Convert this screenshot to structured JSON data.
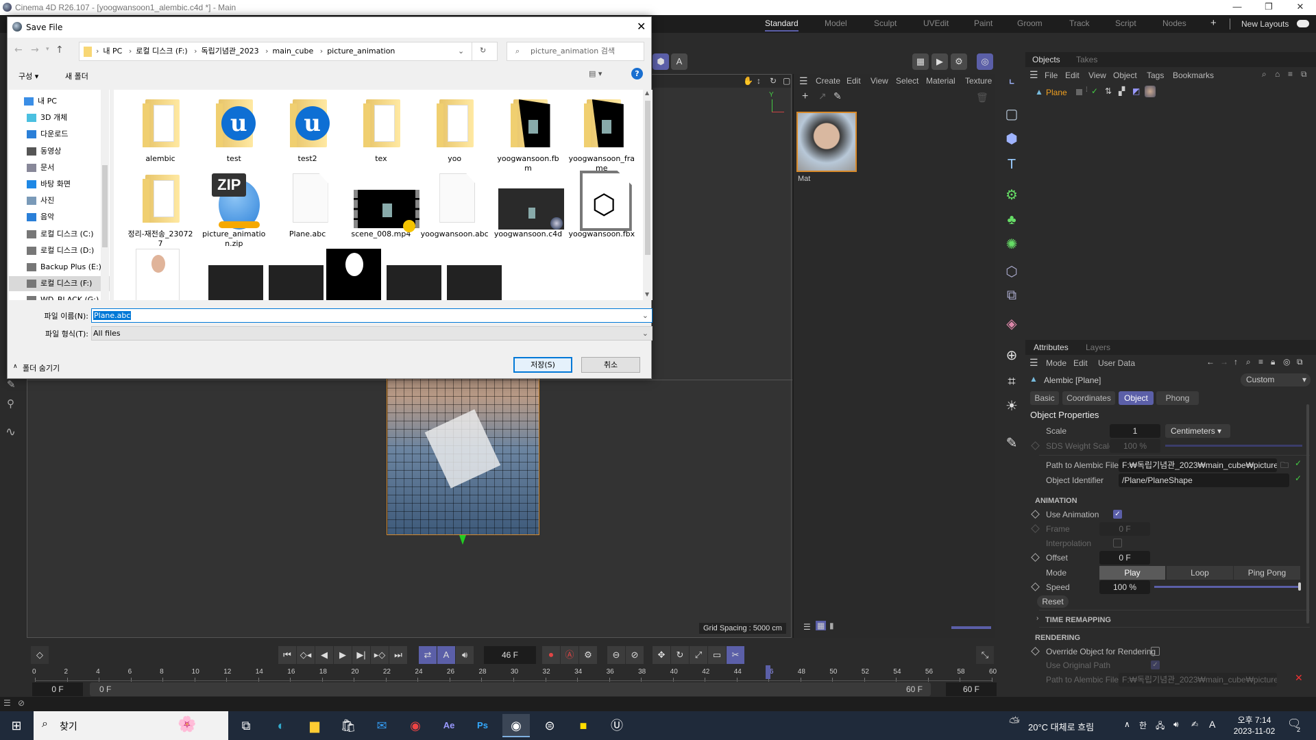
{
  "app": {
    "title": "Cinema 4D R26.107 - [yoogwansoon1_alembic.c4d *] - Main",
    "layouts": [
      "Standard",
      "Model",
      "Sculpt",
      "UVEdit",
      "Paint",
      "Groom",
      "Track",
      "Script",
      "Nodes"
    ],
    "active_layout": "Standard",
    "new_layouts": "New Layouts",
    "accent": "#5b5fa8"
  },
  "dialog": {
    "title": "Save File",
    "breadcrumb": [
      "내 PC",
      "로컬 디스크 (F:)",
      "독립기념관_2023",
      "main_cube",
      "picture_animation"
    ],
    "search_placeholder": "picture_animation 검색",
    "organize": "구성 ▾",
    "new_folder": "새 폴더",
    "nav": [
      {
        "label": "내 PC",
        "icon": "pc-icon"
      },
      {
        "label": "3D 개체",
        "icon": "3d-objects-icon"
      },
      {
        "label": "다운로드",
        "icon": "download-icon"
      },
      {
        "label": "동영상",
        "icon": "video-icon"
      },
      {
        "label": "문서",
        "icon": "document-icon"
      },
      {
        "label": "바탕 화면",
        "icon": "desktop-icon"
      },
      {
        "label": "사진",
        "icon": "pictures-icon"
      },
      {
        "label": "음악",
        "icon": "music-icon"
      },
      {
        "label": "로컬 디스크 (C:)",
        "icon": "drive-icon"
      },
      {
        "label": "로컬 디스크 (D:)",
        "icon": "drive-icon"
      },
      {
        "label": "Backup Plus (E:)",
        "icon": "drive-icon"
      },
      {
        "label": "로컬 디스크 (F:)",
        "icon": "drive-icon"
      },
      {
        "label": "WD_BLACK (G:)",
        "icon": "drive-icon"
      }
    ],
    "selected_nav": "로컬 디스크 (F:)",
    "files": [
      {
        "name": "alembic",
        "type": "folder"
      },
      {
        "name": "test",
        "type": "unreal-folder"
      },
      {
        "name": "test2",
        "type": "unreal-folder"
      },
      {
        "name": "tex",
        "type": "folder"
      },
      {
        "name": "yoo",
        "type": "folder"
      },
      {
        "name": "yoogwansoon.fbm",
        "type": "folder-dark"
      },
      {
        "name": "yoogwansoon_frame",
        "type": "folder-dark"
      },
      {
        "name": "정리-재전송_230727",
        "type": "folder"
      },
      {
        "name": "picture_animation.zip",
        "type": "zip"
      },
      {
        "name": "Plane.abc",
        "type": "file"
      },
      {
        "name": "scene_008.mp4",
        "type": "video"
      },
      {
        "name": "yoogwansoon.abc",
        "type": "file"
      },
      {
        "name": "yoogwansoon.c4d",
        "type": "c4d"
      },
      {
        "name": "yoogwansoon.fbx",
        "type": "fbx"
      }
    ],
    "filename_label": "파일 이름(N):",
    "filename_value": "Plane.abc",
    "filetype_label": "파일 형식(T):",
    "filetype_value": "All files",
    "hide_folders": "폴더 숨기기",
    "save": "저장(S)",
    "cancel": "취소"
  },
  "viewport": {
    "grid_spacing": "Grid Spacing : 5000 cm",
    "axis_label": "Y"
  },
  "material_manager": {
    "menu": [
      "Create",
      "Edit",
      "View",
      "Select",
      "Material",
      "Texture"
    ],
    "materials": [
      {
        "name": "Mat"
      }
    ]
  },
  "objects": {
    "tabs": [
      "Objects",
      "Takes"
    ],
    "menu": [
      "File",
      "Edit",
      "View",
      "Object",
      "Tags",
      "Bookmarks"
    ],
    "items": [
      {
        "name": "Plane"
      }
    ]
  },
  "attributes": {
    "tabs": [
      "Attributes",
      "Layers"
    ],
    "menu": [
      "Mode",
      "Edit",
      "User Data"
    ],
    "object_title": "Alembic [Plane]",
    "preset": "Custom",
    "subtabs": [
      "Basic",
      "Coordinates",
      "Object",
      "Phong"
    ],
    "active_subtab": "Object",
    "section_title": "Object Properties",
    "scale_label": "Scale",
    "scale_value": "1",
    "scale_unit": "Centimeters",
    "sds_label": "SDS Weight Scale",
    "sds_value": "100 %",
    "path_label": "Path to Alembic File",
    "path_value": "F:₩독립기념관_2023₩main_cube₩picture_an",
    "identifier_label": "Object Identifier",
    "identifier_value": "/Plane/PlaneShape",
    "animation_header": "ANIMATION",
    "use_animation_label": "Use Animation",
    "use_animation": true,
    "frame_label": "Frame",
    "frame_value": "0 F",
    "interpolation_label": "Interpolation",
    "interpolation": false,
    "offset_label": "Offset",
    "offset_value": "0 F",
    "mode_label": "Mode",
    "modes": [
      "Play",
      "Loop",
      "Ping Pong"
    ],
    "active_mode": "Play",
    "speed_label": "Speed",
    "speed_value": "100 %",
    "speed_percent": 100,
    "reset": "Reset",
    "time_remapping": "TIME REMAPPING",
    "rendering_header": "RENDERING",
    "override_label": "Override Object for Rendering",
    "override": false,
    "use_original_label": "Use Original Path",
    "use_original": true,
    "render_path_label": "Path to Alembic File",
    "render_path_value": "F:₩독립기념관_2023₩main_cube₩picture_an"
  },
  "timeline": {
    "current_frame": "46 F",
    "current": 46,
    "ticks": [
      0,
      2,
      4,
      6,
      8,
      10,
      12,
      14,
      16,
      18,
      20,
      22,
      24,
      26,
      28,
      30,
      32,
      34,
      36,
      38,
      40,
      42,
      44,
      46,
      48,
      50,
      52,
      54,
      56,
      58,
      60
    ],
    "min": 0,
    "max": 60,
    "start": "0 F",
    "range_start": "0 F",
    "range_end": "60 F",
    "end": "60 F"
  },
  "taskbar": {
    "search": "찾기",
    "weather": "20°C 대체로 흐림",
    "time": "오후 7:14",
    "date": "2023-11-02",
    "notifications": "2",
    "apps": [
      "task-view",
      "edge",
      "file-explorer",
      "store",
      "mail",
      "chrome",
      "after-effects",
      "photoshop",
      "cinema4d",
      "app",
      "kakaotalk",
      "unreal"
    ]
  }
}
